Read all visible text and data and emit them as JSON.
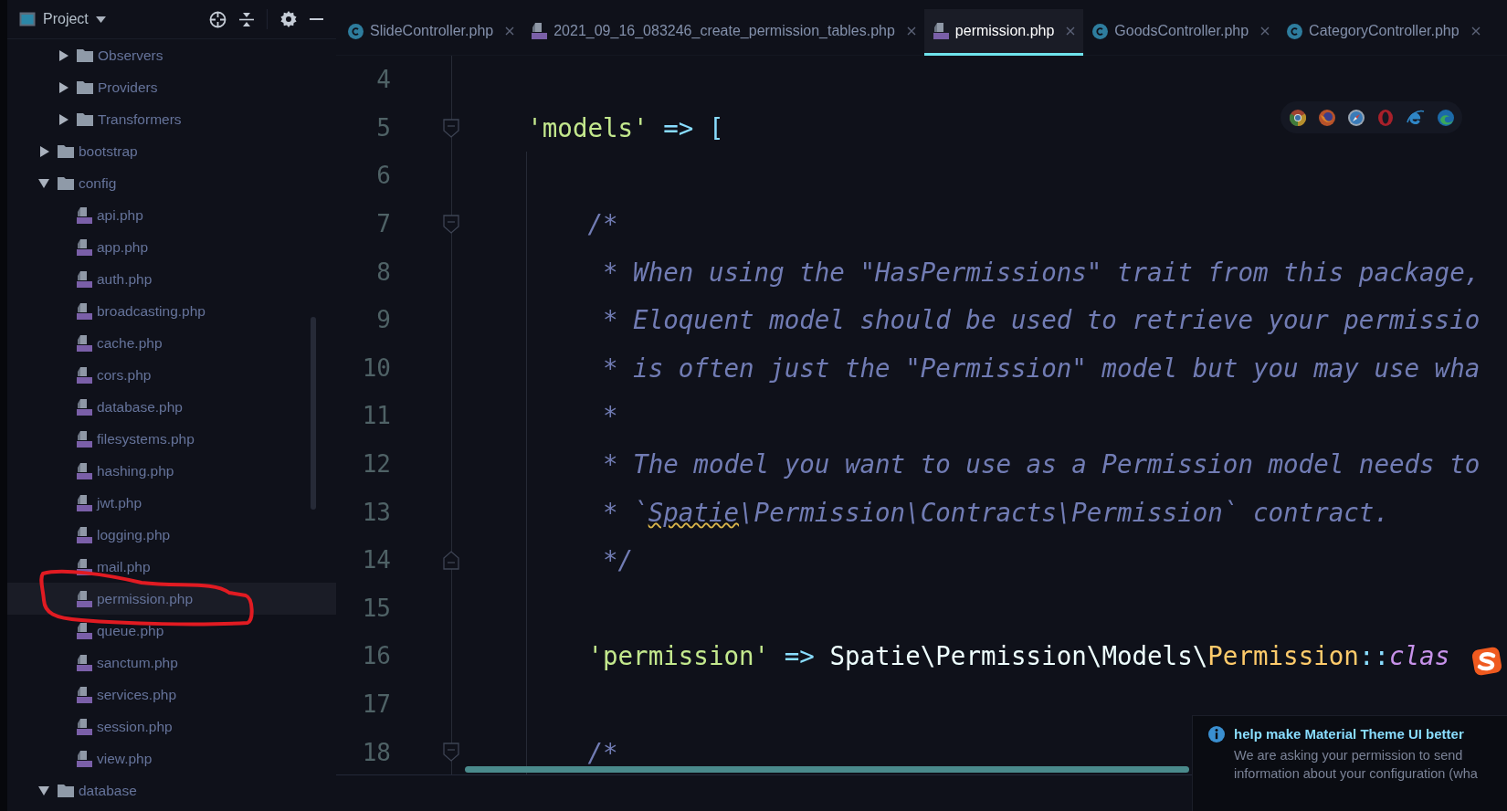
{
  "sidebar": {
    "title": "Project",
    "tree": [
      {
        "kind": "continuation",
        "children": [
          {
            "kind": "folder",
            "label": "Observers",
            "expanded": false,
            "selected": false
          },
          {
            "kind": "folder",
            "label": "Providers",
            "expanded": false,
            "selected": false
          },
          {
            "kind": "folder",
            "label": "Transformers",
            "expanded": false,
            "selected": false
          }
        ]
      },
      {
        "kind": "folder",
        "label": "bootstrap",
        "expanded": false,
        "selected": false
      },
      {
        "kind": "folder",
        "label": "config",
        "expanded": true,
        "selected": false,
        "children": [
          {
            "kind": "file",
            "label": "api.php",
            "selected": false,
            "circled": false
          },
          {
            "kind": "file",
            "label": "app.php",
            "selected": false,
            "circled": false
          },
          {
            "kind": "file",
            "label": "auth.php",
            "selected": false,
            "circled": false
          },
          {
            "kind": "file",
            "label": "broadcasting.php",
            "selected": false,
            "circled": false
          },
          {
            "kind": "file",
            "label": "cache.php",
            "selected": false,
            "circled": false
          },
          {
            "kind": "file",
            "label": "cors.php",
            "selected": false,
            "circled": false
          },
          {
            "kind": "file",
            "label": "database.php",
            "selected": false,
            "circled": false
          },
          {
            "kind": "file",
            "label": "filesystems.php",
            "selected": false,
            "circled": false
          },
          {
            "kind": "file",
            "label": "hashing.php",
            "selected": false,
            "circled": false
          },
          {
            "kind": "file",
            "label": "jwt.php",
            "selected": false,
            "circled": false
          },
          {
            "kind": "file",
            "label": "logging.php",
            "selected": false,
            "circled": false
          },
          {
            "kind": "file",
            "label": "mail.php",
            "selected": false,
            "circled": false
          },
          {
            "kind": "file",
            "label": "permission.php",
            "selected": true,
            "circled": true
          },
          {
            "kind": "file",
            "label": "queue.php",
            "selected": false,
            "circled": false
          },
          {
            "kind": "file",
            "label": "sanctum.php",
            "selected": false,
            "circled": false
          },
          {
            "kind": "file",
            "label": "services.php",
            "selected": false,
            "circled": false
          },
          {
            "kind": "file",
            "label": "session.php",
            "selected": false,
            "circled": false
          },
          {
            "kind": "file",
            "label": "view.php",
            "selected": false,
            "circled": false
          }
        ]
      },
      {
        "kind": "folder",
        "label": "database",
        "expanded": true,
        "selected": false
      }
    ]
  },
  "tabs": [
    {
      "label": "SlideController.php",
      "kind": "class",
      "selected": false
    },
    {
      "label": "2021_09_16_083246_create_permission_tables.php",
      "kind": "php",
      "selected": false
    },
    {
      "label": "permission.php",
      "kind": "php",
      "selected": true
    },
    {
      "label": "GoodsController.php",
      "kind": "class",
      "selected": false
    },
    {
      "label": "CategoryController.php",
      "kind": "class",
      "selected": false
    }
  ],
  "editor": {
    "lines": [
      {
        "number": "4",
        "kind": "plain"
      },
      {
        "number": "5",
        "kind": "fold-start",
        "tokens": [
          {
            "text": "    'models'",
            "kind": "string"
          },
          {
            "text": " => ",
            "kind": "operator"
          },
          {
            "text": "[",
            "kind": "operator"
          }
        ]
      },
      {
        "number": "6",
        "kind": "plain"
      },
      {
        "number": "7",
        "kind": "fold-start",
        "tokens": [
          {
            "text": "        /*",
            "kind": "comment"
          }
        ]
      },
      {
        "number": "8",
        "kind": "plain",
        "tokens": [
          {
            "text": "         * When using the \"HasPermissions\" trait from this package,",
            "kind": "comment"
          }
        ]
      },
      {
        "number": "9",
        "kind": "plain",
        "tokens": [
          {
            "text": "         * Eloquent model should be used to retrieve your permissio",
            "kind": "comment"
          }
        ]
      },
      {
        "number": "10",
        "kind": "plain",
        "tokens": [
          {
            "text": "         * is often just the \"Permission\" model but you may use wha",
            "kind": "comment"
          }
        ]
      },
      {
        "number": "11",
        "kind": "plain",
        "tokens": [
          {
            "text": "         *",
            "kind": "comment"
          }
        ]
      },
      {
        "number": "12",
        "kind": "plain",
        "tokens": [
          {
            "text": "         * The model you want to use as a Permission model needs to",
            "kind": "comment"
          }
        ]
      },
      {
        "number": "13",
        "kind": "plain",
        "tokens": [
          {
            "text": "         * `",
            "kind": "comment"
          },
          {
            "text": "Spatie",
            "kind": "typo"
          },
          {
            "text": "\\Permission\\Contracts\\Permission` contract.",
            "kind": "comment"
          }
        ]
      },
      {
        "number": "14",
        "kind": "fold-end",
        "tokens": [
          {
            "text": "         */",
            "kind": "comment"
          }
        ]
      },
      {
        "number": "15",
        "kind": "plain"
      },
      {
        "number": "16",
        "kind": "plain",
        "tokens": [
          {
            "text": "        'permission'",
            "kind": "string"
          },
          {
            "text": " => ",
            "kind": "operator"
          },
          {
            "text": "Spatie\\Permission\\Models\\",
            "kind": "plain"
          },
          {
            "text": "Permission",
            "kind": "class"
          },
          {
            "text": "::",
            "kind": "operator"
          },
          {
            "text": "clas",
            "kind": "constant"
          }
        ]
      },
      {
        "number": "17",
        "kind": "plain"
      },
      {
        "number": "18",
        "kind": "fold-start",
        "tokens": [
          {
            "text": "        /*",
            "kind": "comment"
          }
        ]
      }
    ]
  },
  "notification": {
    "title": "help make Material Theme UI better",
    "body_lines": [
      "We are asking your permission to send",
      "information about your configuration (wha"
    ]
  }
}
